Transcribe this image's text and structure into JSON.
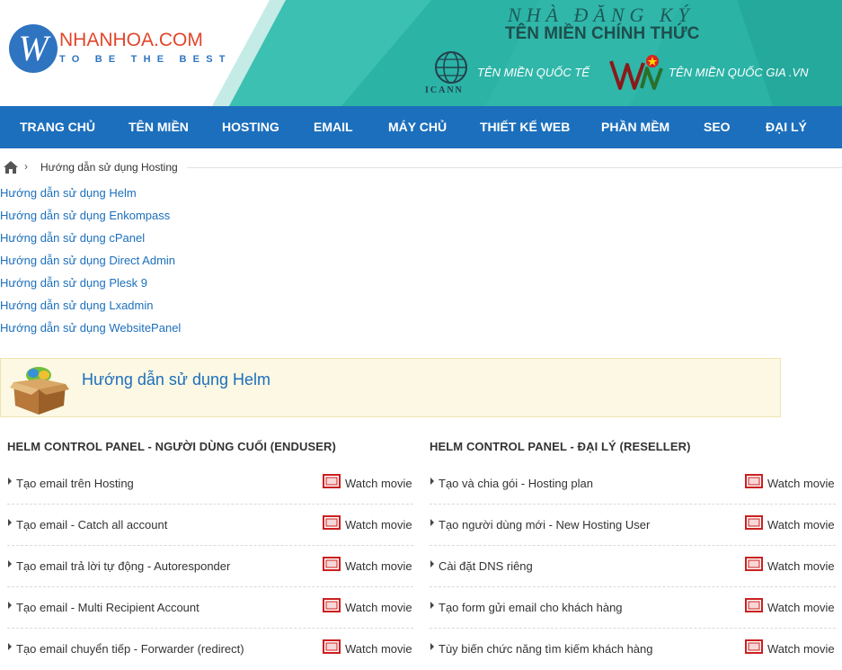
{
  "header": {
    "logo_letter": "W",
    "logo_name": "NHANHOA.COM",
    "logo_tagline": "TO BE THE BEST",
    "registrar_line1": "NHÀ ĐĂNG KÝ",
    "registrar_line2": "TÊN MIỀN CHÍNH THỨC",
    "icann_label": "ICANN",
    "intl_domain_label": "TÊN MIỀN QUỐC TẾ",
    "vnnic_label": "VNNIC",
    "national_domain_label": "TÊN MIỀN QUỐC GIA .VN",
    "colors": {
      "teal": "#2bb3a6",
      "brand_blue": "#2f74c0",
      "brand_red": "#e2452b"
    }
  },
  "nav": {
    "items": [
      {
        "label": "TRANG CHỦ"
      },
      {
        "label": "TÊN MIỀN"
      },
      {
        "label": "HOSTING"
      },
      {
        "label": "EMAIL"
      },
      {
        "label": "MÁY CHỦ"
      },
      {
        "label": "THIẾT KẾ WEB"
      },
      {
        "label": "PHẦN MỀM"
      },
      {
        "label": "SEO"
      },
      {
        "label": "ĐẠI LÝ"
      }
    ],
    "color": "#1c6fbc"
  },
  "breadcrumb": {
    "home_icon": "home-icon",
    "separator": "›",
    "current": "Hướng dẫn sử dụng Hosting"
  },
  "guide_links": [
    "Hướng dẫn sử dụng Helm",
    "Hướng dẫn sử dụng Enkompass",
    "Hướng dẫn sử dụng cPanel",
    "Hướng dẫn sử dụng Direct Admin",
    "Hướng dẫn sử dụng Plesk 9",
    "Hướng dẫn sử dụng Lxadmin",
    "Hướng dẫn sử dụng WebsitePanel"
  ],
  "section": {
    "icon": "package-box-icon",
    "title": "Hướng dẫn sử dụng Helm"
  },
  "columns": [
    {
      "title": "HELM CONTROL PANEL - NGƯỜI DÙNG CUỐI (ENDUSER)",
      "rows": [
        {
          "label": "Tạo email trên Hosting",
          "action": "Watch movie"
        },
        {
          "label": "Tạo email - Catch all account",
          "action": "Watch movie"
        },
        {
          "label": "Tạo email trả lời tự động - Autoresponder",
          "action": "Watch movie"
        },
        {
          "label": "Tạo email - Multi Recipient Account",
          "action": "Watch movie"
        },
        {
          "label": "Tạo email chuyển tiếp - Forwarder (redirect)",
          "action": "Watch movie"
        }
      ]
    },
    {
      "title": "HELM CONTROL PANEL - ĐẠI LÝ (RESELLER)",
      "rows": [
        {
          "label": "Tạo và chia gói - Hosting plan",
          "action": "Watch movie"
        },
        {
          "label": "Tạo người dùng mới - New Hosting User",
          "action": "Watch movie"
        },
        {
          "label": "Cài đặt DNS riêng",
          "action": "Watch movie"
        },
        {
          "label": "Tạo form gửi email cho khách hàng",
          "action": "Watch movie"
        },
        {
          "label": "Tùy biến chức năng tìm kiếm khách hàng",
          "action": "Watch movie"
        }
      ]
    }
  ]
}
